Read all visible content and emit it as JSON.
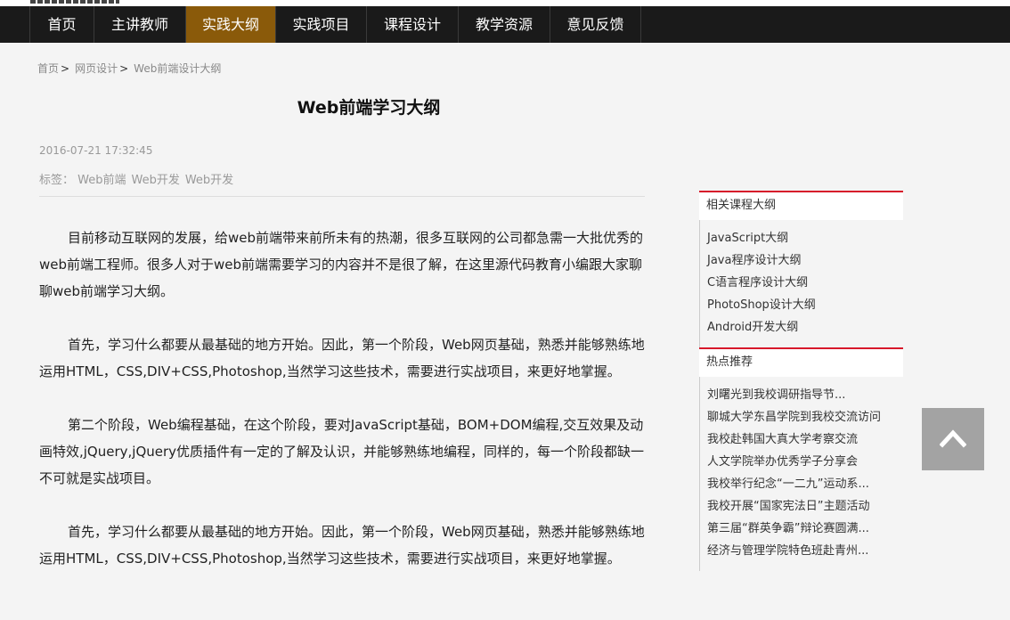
{
  "nav": {
    "items": [
      {
        "label": "首页",
        "active": false
      },
      {
        "label": "主讲教师",
        "active": false
      },
      {
        "label": "实践大纲",
        "active": true
      },
      {
        "label": "实践项目",
        "active": false
      },
      {
        "label": "课程设计",
        "active": false
      },
      {
        "label": "教学资源",
        "active": false
      },
      {
        "label": "意见反馈",
        "active": false
      }
    ]
  },
  "breadcrumb": {
    "home": "首页",
    "category": "网页设计",
    "current": "Web前端设计大纲",
    "separator": ">"
  },
  "article": {
    "title": "Web前端学习大纲",
    "date": "2016-07-21 17:32:45",
    "tags_label": "标签：",
    "tags": [
      "Web前端",
      "Web开发",
      "Web开发"
    ],
    "paragraphs": [
      "目前移动互联网的发展，给web前端带来前所未有的热潮，很多互联网的公司都急需一大批优秀的web前端工程师。很多人对于web前端需要学习的内容并不是很了解，在这里源代码教育小编跟大家聊聊web前端学习大纲。",
      "首先，学习什么都要从最基础的地方开始。因此，第一个阶段，Web网页基础，熟悉并能够熟练地运用HTML，CSS,DIV+CSS,Photoshop,当然学习这些技术，需要进行实战项目，来更好地掌握。",
      "第二个阶段，Web编程基础，在这个阶段，要对JavaScript基础，BOM+DOM编程,交互效果及动画特效,jQuery,jQuery优质插件有一定的了解及认识，并能够熟练地编程，同样的，每一个阶段都缺一不可就是实战项目。",
      "首先，学习什么都要从最基础的地方开始。因此，第一个阶段，Web网页基础，熟悉并能够熟练地运用HTML，CSS,DIV+CSS,Photoshop,当然学习这些技术，需要进行实战项目，来更好地掌握。"
    ]
  },
  "sidebar": {
    "related": {
      "title": "相关课程大纲",
      "items": [
        "JavaScript大纲",
        "Java程序设计大纲",
        "C语言程序设计大纲",
        "PhotoShop设计大纲",
        "Android开发大纲"
      ]
    },
    "hot": {
      "title": "热点推荐",
      "items": [
        "刘曙光到我校调研指导节...",
        "聊城大学东昌学院到我校交流访问",
        "我校赴韩国大真大学考察交流",
        "人文学院举办优秀学子分享会",
        "我校举行纪念“一二九”运动系...",
        "我校开展“国家宪法日”主题活动",
        "第三届“群英争霸”辩论赛圆满...",
        "经济与管理学院特色班赴青州..."
      ]
    }
  },
  "colors": {
    "nav_bg": "#1a1a1a",
    "nav_active": "#8a5a0a",
    "sidebar_accent": "#d7182a",
    "backtop_bg": "#a3a3a3"
  },
  "icons": {
    "back_to_top": "chevron-up-icon"
  }
}
